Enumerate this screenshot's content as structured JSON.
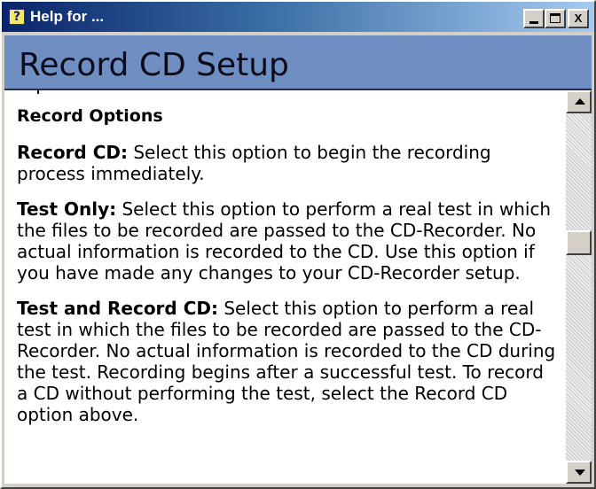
{
  "window": {
    "title": "Help for ...",
    "icon": "help-question-icon",
    "buttons": {
      "minimize": "_",
      "maximize": "□",
      "close": "X"
    }
  },
  "header": {
    "title": "Record CD Setup"
  },
  "content": {
    "section_title": "Record Options",
    "items": [
      {
        "term": "Record CD:",
        "text": " Select this option to begin the recording process immediately."
      },
      {
        "term": "Test Only:",
        "text": " Select this option to perform a real test in which the files to be recorded are passed to the CD-Recorder. No actual information is recorded to the CD. Use this option if you have made any changes to your CD-Recorder setup."
      },
      {
        "term": "Test and Record CD:",
        "text": " Select this option to perform a real test in which the files to be recorded are passed to the CD-Recorder. No actual information is recorded to the CD during the test. Recording begins after a successful test. To record a CD without performing the test, select the Record CD option above."
      }
    ]
  },
  "scrollbar": {
    "position_fraction": 0.4
  },
  "colors": {
    "titlebar_start": "#0a246a",
    "titlebar_end": "#a6caf0",
    "header_bg": "#6f8fc3",
    "face": "#d4d0c8"
  }
}
